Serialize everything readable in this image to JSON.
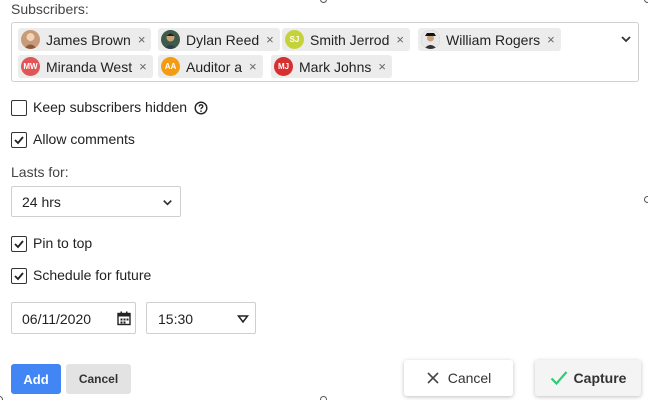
{
  "subscribers": {
    "label": "Subscribers:",
    "chips": [
      {
        "name": "James Brown",
        "initials": "",
        "color": "#c89a7a"
      },
      {
        "name": "Dylan Reed",
        "initials": "",
        "color": "#3d5a4a"
      },
      {
        "name": "Smith Jerrod",
        "initials": "SJ",
        "color": "#c6d23a"
      },
      {
        "name": "William Rogers",
        "initials": "",
        "color": "#5a5a5a"
      },
      {
        "name": "Miranda West",
        "initials": "MW",
        "color": "#e05555"
      },
      {
        "name": "Auditor a",
        "initials": "AA",
        "color": "#f39c12"
      },
      {
        "name": "Mark Johns",
        "initials": "MJ",
        "color": "#d63031"
      }
    ],
    "remove_glyph": "×",
    "dropdown_icon": "chevron-down-icon"
  },
  "options": {
    "keep_hidden": {
      "label": "Keep subscribers hidden",
      "checked": false
    },
    "allow_comments": {
      "label": "Allow comments",
      "checked": true
    },
    "pin_to_top": {
      "label": "Pin to top",
      "checked": true
    },
    "schedule": {
      "label": "Schedule for future",
      "checked": true
    }
  },
  "lasts_for": {
    "label": "Lasts for:",
    "value": "24 hrs"
  },
  "schedule_fields": {
    "date": "06/11/2020",
    "time": "15:30"
  },
  "actions": {
    "add": "Add",
    "cancel": "Cancel"
  },
  "floating": {
    "cancel": "Cancel",
    "capture": "Capture",
    "capture_color": "#2ecc71"
  },
  "colors": {
    "primary": "#4285f4"
  }
}
